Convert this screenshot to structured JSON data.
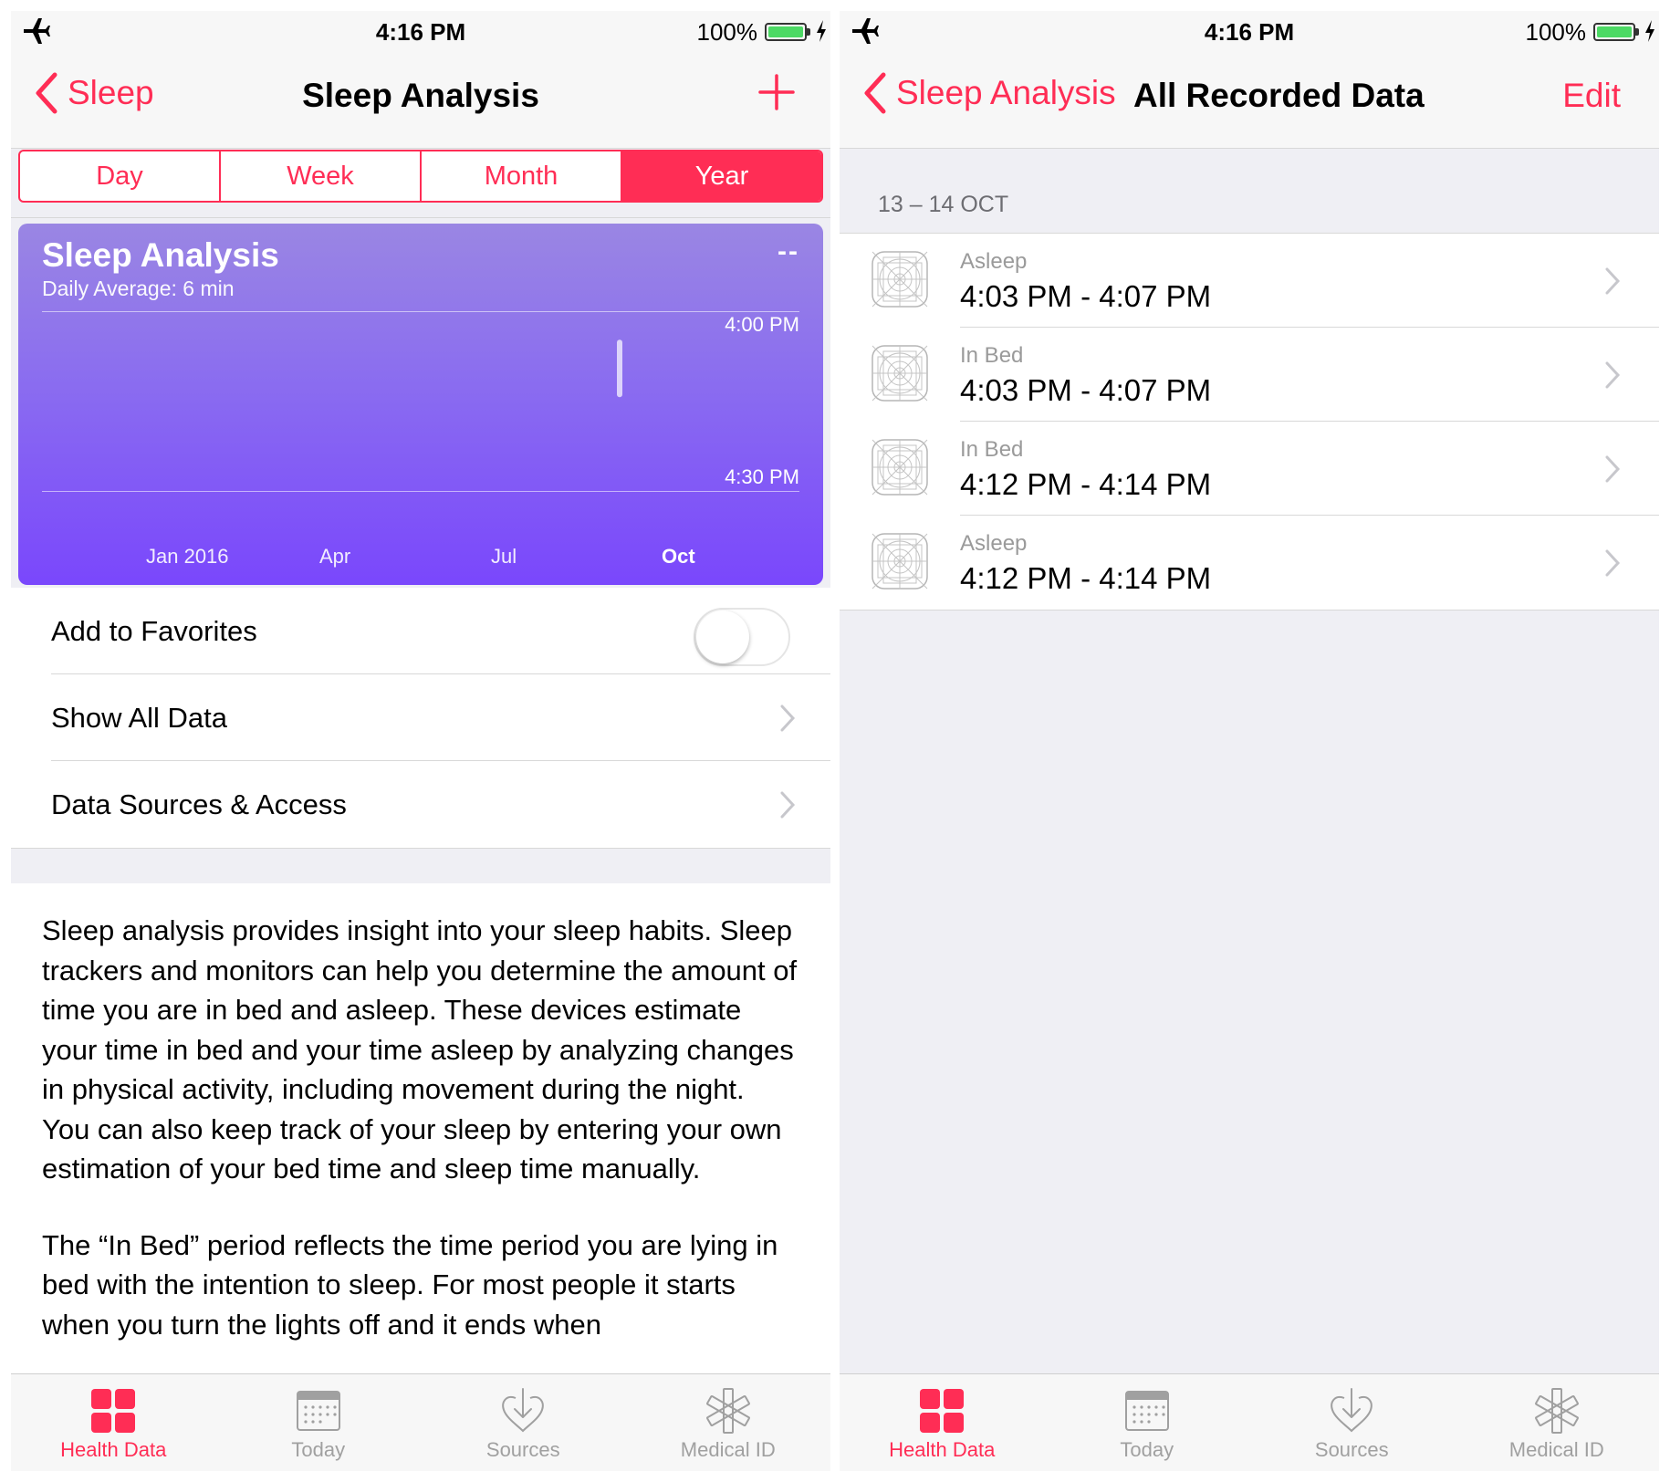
{
  "colors": {
    "accent": "#ff2d55",
    "battery": "#4cd964",
    "chart_top": "#9a86e3",
    "chart_bottom": "#7a47fc"
  },
  "status_bar": {
    "time": "4:16 PM",
    "battery": "100%",
    "airplane_icon": "airplane-icon",
    "charging_icon": "bolt-icon"
  },
  "left": {
    "nav": {
      "back_label": "Sleep",
      "title": "Sleep Analysis",
      "add_icon": "plus-icon"
    },
    "segments": [
      {
        "label": "Day",
        "active": false
      },
      {
        "label": "Week",
        "active": false
      },
      {
        "label": "Month",
        "active": false
      },
      {
        "label": "Year",
        "active": true
      }
    ],
    "chart": {
      "title": "Sleep Analysis",
      "subtitle": "Daily Average: 6 min",
      "value_label": "--"
    },
    "chart_data": {
      "type": "bar",
      "title": "Sleep Analysis",
      "subtitle": "Daily Average: 6 min",
      "x_tick_labels": [
        "Jan 2016",
        "Apr",
        "Jul",
        "Oct"
      ],
      "x_tick_bold": [
        false,
        false,
        false,
        true
      ],
      "y_tick_labels": [
        "4:00 PM",
        "4:30 PM"
      ],
      "y_range_minutes": [
        0,
        30
      ],
      "y_axis_inverted": true,
      "series": [
        {
          "values": [
            {
              "month": "Oct 2016",
              "start_minute": 3,
              "end_minute": 14
            }
          ]
        }
      ],
      "grid": false
    },
    "settings": {
      "favorites_label": "Add to Favorites",
      "favorites_on": false,
      "show_all_label": "Show All Data",
      "sources_label": "Data Sources & Access"
    },
    "description": [
      "Sleep analysis provides insight into your sleep habits. Sleep trackers and monitors can help you determine the amount of time you are in bed and asleep. These devices estimate your time in bed and your time asleep by analyzing changes in physical activity, including movement during the night. You can also keep track of your sleep by entering your own estimation of your bed time and sleep time manually.",
      "The “In Bed” period reflects the time period you are lying in bed with the intention to sleep. For most people it starts when you turn the lights off and it ends when"
    ]
  },
  "right": {
    "nav": {
      "back_label": "Sleep Analysis",
      "title": "All Recorded Data",
      "edit_label": "Edit"
    },
    "section_header": "13 – 14 OCT",
    "records": [
      {
        "type": "Asleep",
        "time": "4:03 PM - 4:07 PM"
      },
      {
        "type": "In Bed",
        "time": "4:03 PM - 4:07 PM"
      },
      {
        "type": "In Bed",
        "time": "4:12 PM - 4:14 PM"
      },
      {
        "type": "Asleep",
        "time": "4:12 PM - 4:14 PM"
      }
    ]
  },
  "tab_bar": [
    {
      "label": "Health Data",
      "icon": "health-data-icon",
      "active": true
    },
    {
      "label": "Today",
      "icon": "calendar-icon",
      "active": false
    },
    {
      "label": "Sources",
      "icon": "sources-heart-icon",
      "active": false
    },
    {
      "label": "Medical ID",
      "icon": "medical-id-icon",
      "active": false
    }
  ]
}
